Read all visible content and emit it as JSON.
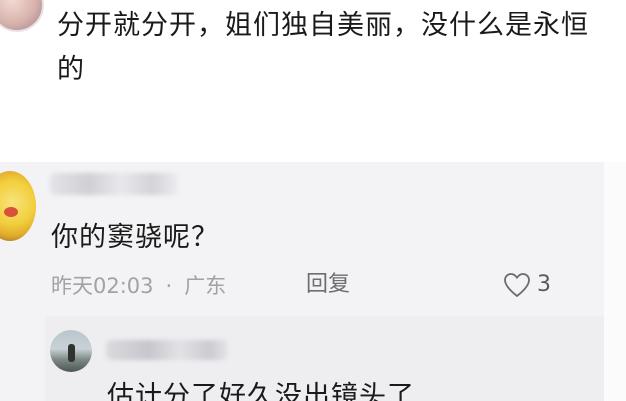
{
  "previous_comment": {
    "text": "分开就分开，姐们独自美丽，没什么是永恒的"
  },
  "comment": {
    "text": "你的窦骁呢？",
    "time": "昨天02:03",
    "separator": "·",
    "location": "广东",
    "reply_label": "回复",
    "like_count": "3"
  },
  "sub_reply": {
    "text": "估计分了好久没出镜头了"
  }
}
